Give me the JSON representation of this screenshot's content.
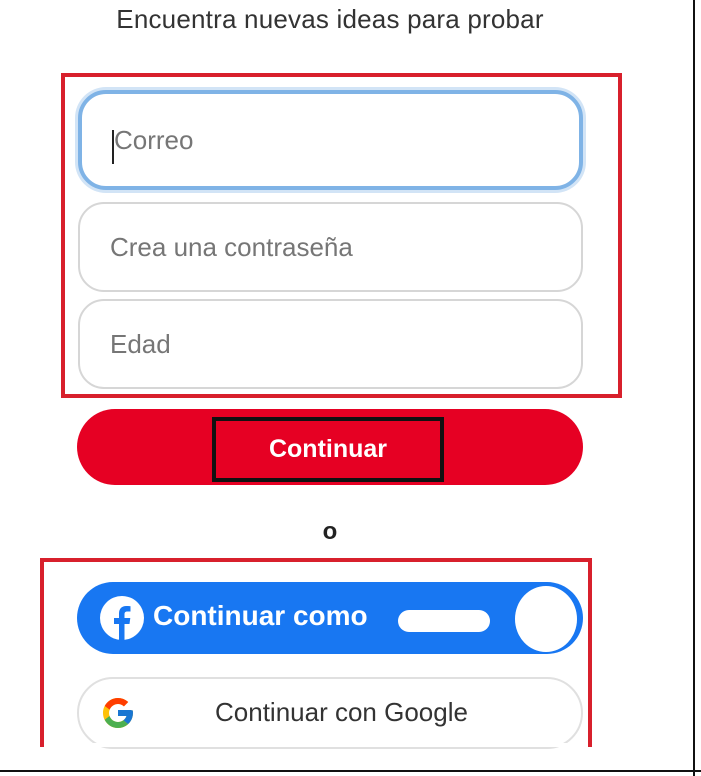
{
  "header": {
    "subtitle": "Encuentra nuevas ideas para probar"
  },
  "form": {
    "email_placeholder": "Correo",
    "password_placeholder": "Crea una contraseña",
    "age_placeholder": "Edad",
    "continue_label": "Continuar"
  },
  "divider": {
    "or_label": "o"
  },
  "social": {
    "facebook_label": "Continuar como",
    "google_label": "Continuar con Google"
  },
  "icons": {
    "facebook": "facebook-icon",
    "google": "google-icon"
  },
  "colors": {
    "brand_red": "#e60023",
    "facebook_blue": "#1877f2",
    "annotation_red": "#d8202c",
    "focus_blue": "#7fb3e6"
  }
}
